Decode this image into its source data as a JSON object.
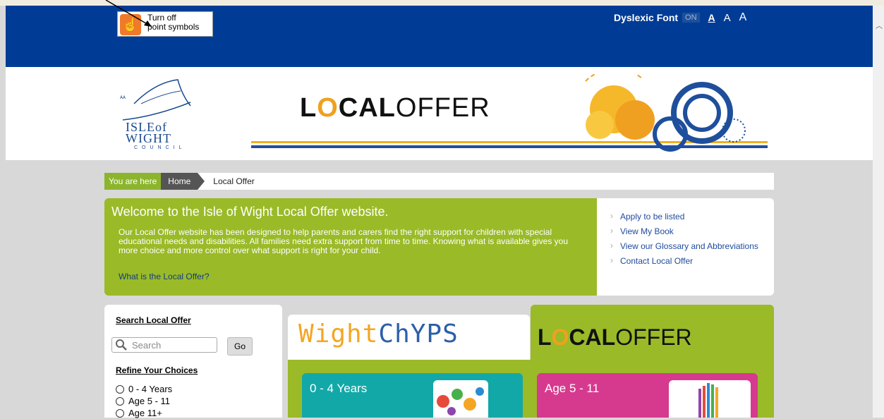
{
  "tooltip": {
    "text_line1": "Turn off",
    "text_line2": "point symbols"
  },
  "accessibility": {
    "dyslexic_label": "Dyslexic Font",
    "toggle_state": "ON",
    "size_small": "A",
    "size_medium": "A",
    "size_large": "A"
  },
  "logo": {
    "org_name": "ISLE of WIGHT",
    "org_name_line1": "ISLEof",
    "org_name_line2": "WIGHT",
    "council": "COUNCIL"
  },
  "header": {
    "title_bold_L": "L",
    "title_o": "O",
    "title_bold_rest": "CAL",
    "title_rest": "OFFER"
  },
  "breadcrumb": {
    "here_label": "You are here",
    "home_label": "Home",
    "current": "Local Offer"
  },
  "welcome": {
    "heading": "Welcome to the Isle of Wight Local Offer website.",
    "body": "Our Local Offer website has been designed to help parents and carers find the right support for children with special educational needs and disabilities. All families need extra support from time to time. Knowing what is available gives you more choice and more control over what support is right for your child.",
    "link": "What is the Local Offer?"
  },
  "quick_links": [
    "Apply to be listed",
    "View My Book",
    "View our Glossary and Abbreviations",
    "Contact Local Offer"
  ],
  "search": {
    "title": "Search Local Offer",
    "placeholder": "Search",
    "go_label": "Go",
    "refine_title": "Refine Your Choices",
    "options": [
      "0 - 4 Years",
      "Age 5 - 11",
      "Age 11+"
    ]
  },
  "tabs": {
    "wight_w": "W",
    "wight_ight": "ight",
    "wight_chyps": "ChYPS",
    "local_L": "L",
    "local_O": "O",
    "local_cal": "CAL",
    "local_offer": "OFFER"
  },
  "tiles": [
    {
      "label": "0 - 4 Years"
    },
    {
      "label": "Age 5 - 11"
    }
  ],
  "colors": {
    "header_blue": "#003c96",
    "green": "#9aba28",
    "teal": "#13a8a8",
    "magenta": "#d63a8e",
    "orange": "#f0a020"
  }
}
